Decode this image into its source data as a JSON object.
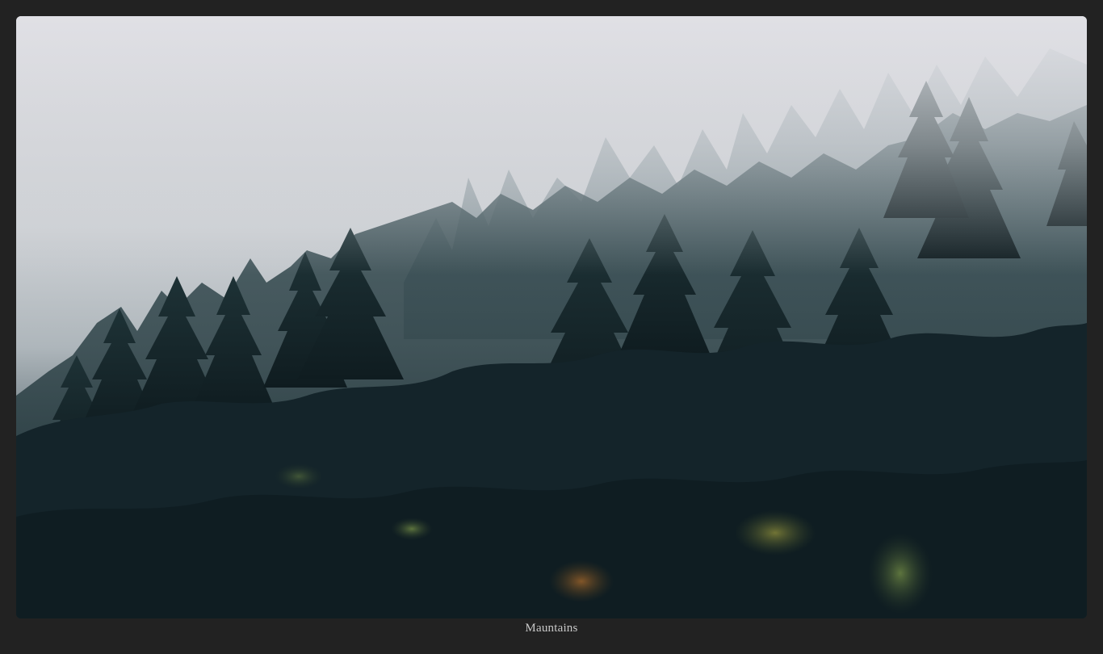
{
  "image": {
    "caption": "Mauntains",
    "subject_icon": "misty-forest-photo"
  },
  "colors": {
    "page_background": "#222222",
    "caption_text": "#c8c8c8",
    "fog": "#dcdde2",
    "forest_dark": "#102027"
  }
}
